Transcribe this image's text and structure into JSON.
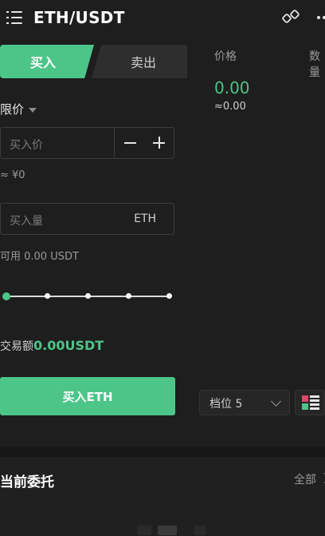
{
  "header": {
    "pair": "ETH/USDT",
    "menu_icon": "menu-list-icon",
    "compare_icon": "switch-pair-icon",
    "more_icon": "more-dots-icon"
  },
  "tabs": {
    "buy": "买入",
    "sell": "卖出"
  },
  "orderbook": {
    "price_header": "价格",
    "amount_header": "数量",
    "last_price": "0.00",
    "last_price_approx": "≈0.00"
  },
  "order_form": {
    "order_type": "限价",
    "price_placeholder": "买入价",
    "price_fiat_approx": "≈ ¥0",
    "amount_placeholder": "买入量",
    "amount_unit": "ETH",
    "available": "可用 0.00 USDT",
    "slider_percent": 0,
    "trade_amount_label": "交易额",
    "trade_amount_value": "0.00USDT",
    "submit_label": "买入ETH"
  },
  "depth": {
    "select_value": "档位 5"
  },
  "open_orders": {
    "title": "当前委托",
    "all_label": "全部"
  },
  "colors": {
    "accent_green": "#4cc589",
    "sell_red": "#e0466a",
    "background": "#1e1e1e"
  }
}
